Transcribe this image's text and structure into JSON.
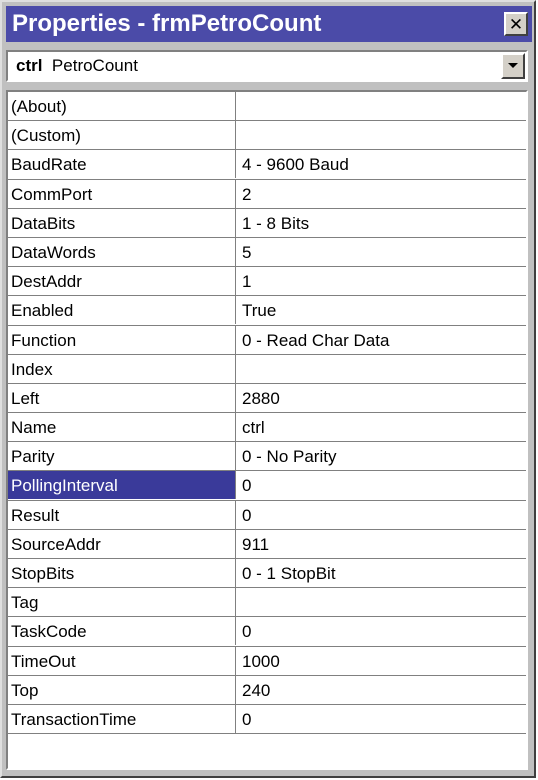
{
  "window": {
    "title": "Properties - frmPetroCount",
    "close_glyph": "✕"
  },
  "object_selector": {
    "object_name": "ctrl",
    "object_type": "PetroCount"
  },
  "properties": [
    {
      "name": "(About)",
      "value": ""
    },
    {
      "name": "(Custom)",
      "value": ""
    },
    {
      "name": "BaudRate",
      "value": "4 - 9600 Baud"
    },
    {
      "name": "CommPort",
      "value": "2"
    },
    {
      "name": "DataBits",
      "value": "1 - 8 Bits"
    },
    {
      "name": "DataWords",
      "value": "5"
    },
    {
      "name": "DestAddr",
      "value": "1"
    },
    {
      "name": "Enabled",
      "value": "True"
    },
    {
      "name": "Function",
      "value": "0 - Read Char Data"
    },
    {
      "name": "Index",
      "value": ""
    },
    {
      "name": "Left",
      "value": "2880"
    },
    {
      "name": "Name",
      "value": "ctrl"
    },
    {
      "name": "Parity",
      "value": "0 - No Parity"
    },
    {
      "name": "PollingInterval",
      "value": "0",
      "selected": true
    },
    {
      "name": "Result",
      "value": "0"
    },
    {
      "name": "SourceAddr",
      "value": "911"
    },
    {
      "name": "StopBits",
      "value": "0 - 1 StopBit"
    },
    {
      "name": "Tag",
      "value": ""
    },
    {
      "name": "TaskCode",
      "value": "0"
    },
    {
      "name": "TimeOut",
      "value": "1000"
    },
    {
      "name": "Top",
      "value": "240"
    },
    {
      "name": "TransactionTime",
      "value": "0"
    }
  ],
  "colors": {
    "titlebar": "#4b4ba8",
    "selection": "#3a3a9a"
  }
}
